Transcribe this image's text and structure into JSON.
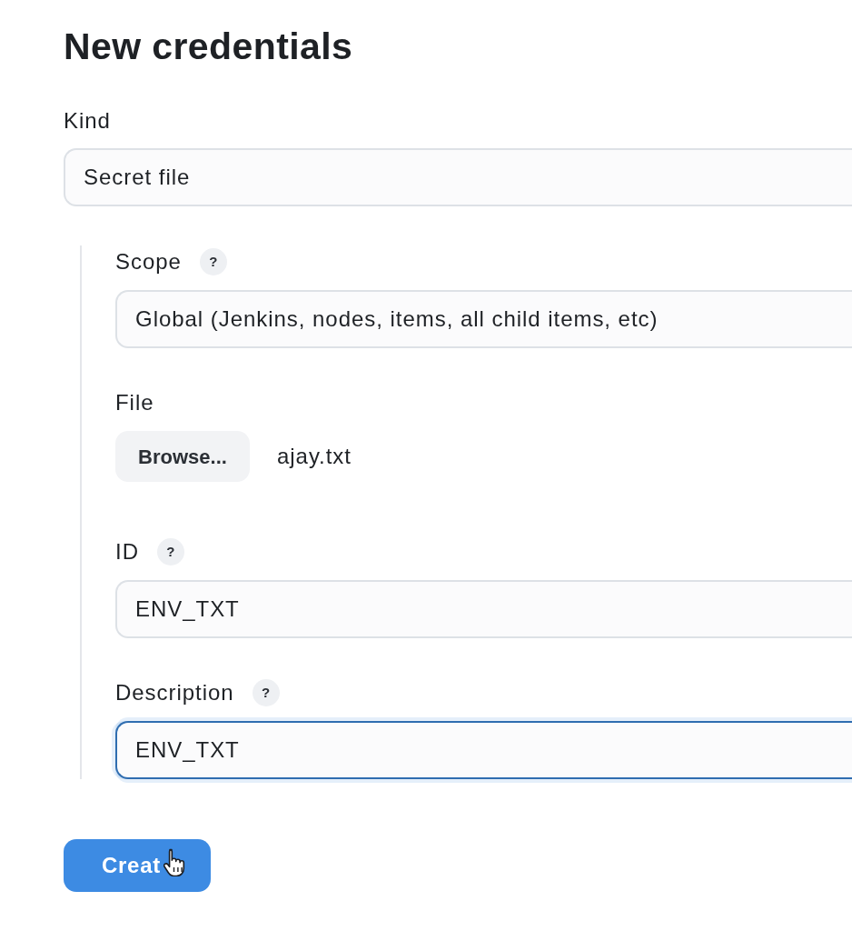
{
  "title": "New credentials",
  "kind": {
    "label": "Kind",
    "value": "Secret file"
  },
  "section": {
    "fields": [
      {
        "kind": "select",
        "label": "Scope",
        "help": "?",
        "value": "Global (Jenkins, nodes, items, all child items, etc)",
        "focused": false
      },
      {
        "kind": "file",
        "label": "File",
        "button": "Browse...",
        "filename": "ajay.txt",
        "focused": false
      },
      {
        "kind": "text",
        "label": "ID",
        "help": "?",
        "value": "ENV_TXT",
        "focused": false
      },
      {
        "kind": "text",
        "label": "Description",
        "help": "?",
        "value": "ENV_TXT",
        "focused": true
      }
    ]
  },
  "create_button": {
    "label": "Creat"
  }
}
